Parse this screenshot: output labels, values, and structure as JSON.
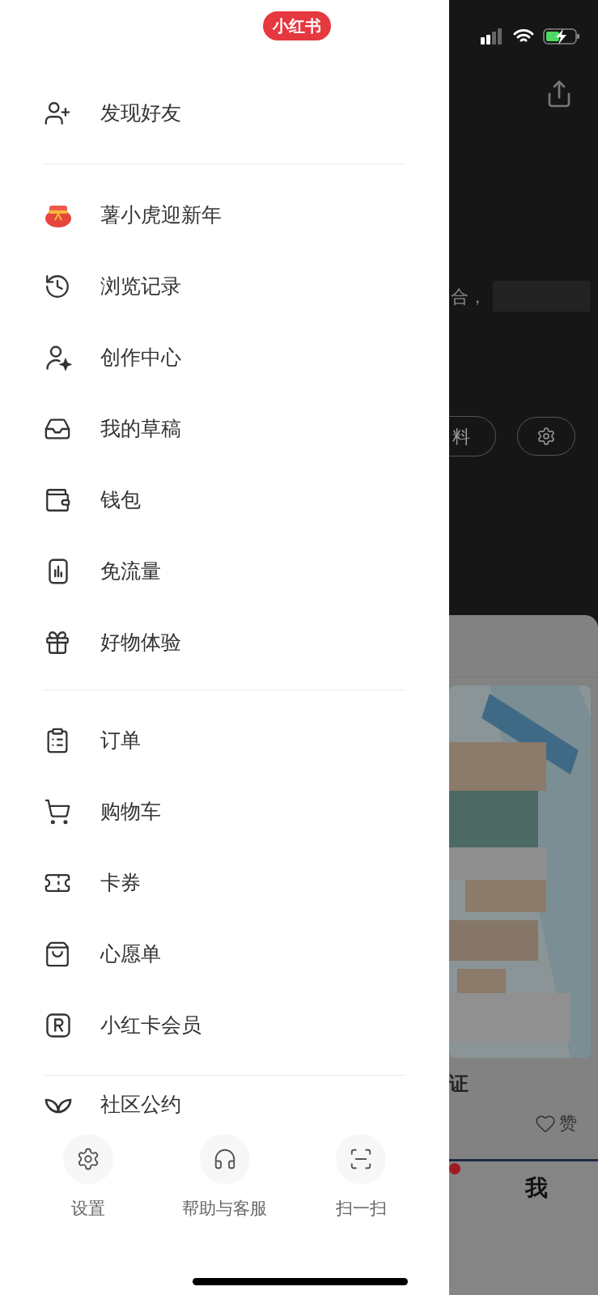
{
  "drawer": {
    "logo": "小红书",
    "sections": [
      [
        "发现好友"
      ],
      [
        "薯小虎迎新年",
        "浏览记录",
        "创作中心",
        "我的草稿",
        "钱包",
        "免流量",
        "好物体验"
      ],
      [
        "订单",
        "购物车",
        "卡券",
        "心愿单",
        "小红卡会员"
      ],
      [
        "社区公约"
      ]
    ],
    "bottom_actions": [
      "设置",
      "帮助与客服",
      "扫一扫"
    ]
  },
  "background_page": {
    "profile_text": "合，",
    "edit_button": "料",
    "note_title": "证",
    "like_label": "赞",
    "tab_label": "我"
  }
}
